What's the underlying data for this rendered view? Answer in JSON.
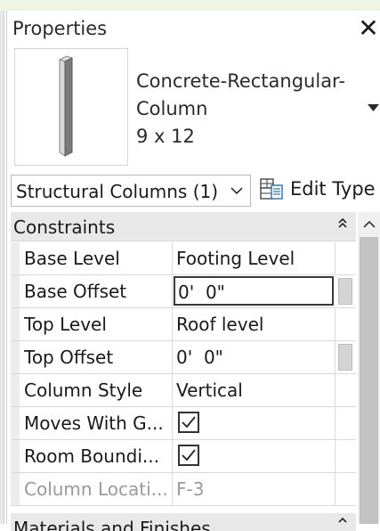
{
  "panel": {
    "title": "Properties",
    "close_glyph": "✕"
  },
  "type_selector": {
    "name_lines": [
      "Concrete-Rectangular-",
      "Column",
      "9 x 12"
    ],
    "thumbnail_icon": "column-3d-icon"
  },
  "filter": {
    "selected": "Structural Columns (1)",
    "visible_text": "Structural Columns (1)"
  },
  "edit_type": {
    "label": "Edit Type",
    "icon": "edit-type-icon"
  },
  "section": {
    "label": "Constraints",
    "collapse_glyph": "⌃⌃"
  },
  "properties": [
    {
      "name": "Base Level",
      "value": "Footing Level"
    },
    {
      "name": "Base Offset",
      "value": "0'  0\""
    },
    {
      "name": "Top Level",
      "value": "Roof level"
    },
    {
      "name": "Top Offset",
      "value": "0'  0\""
    },
    {
      "name": "Column Style",
      "value": "Vertical"
    },
    {
      "name": "Moves With G...",
      "checked": true
    },
    {
      "name": "Room Boundi...",
      "checked": true
    },
    {
      "name": "Column Locati...",
      "value": "F-3"
    }
  ],
  "next_section": {
    "label": "Materials and Finishes"
  },
  "colors": {
    "header_bg": "#e8e8e8",
    "disabled_text": "#9a9a9a",
    "top_strip": "#eef5e2"
  }
}
